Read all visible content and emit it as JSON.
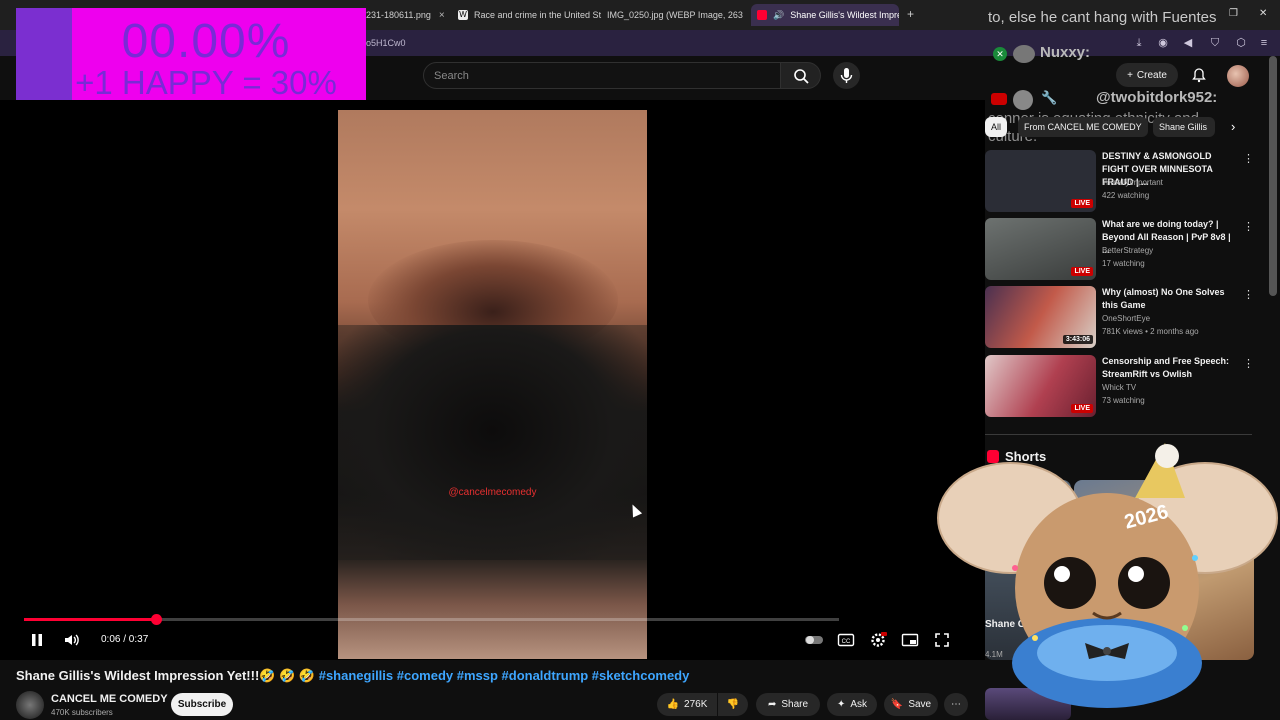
{
  "browser": {
    "tabs": [
      {
        "label": "1231-180611.png",
        "x": 0
      },
      {
        "label": "Race and crime in the United St",
        "x": 1
      },
      {
        "label": "IMG_0250.jpg (WEBP Image, 263",
        "x": 2
      },
      {
        "label": "Shane Gillis's Wildest Impre",
        "x": 3
      }
    ],
    "url_fragment": "o5H1Cw0"
  },
  "overlay": {
    "percent": "00.00%",
    "rule": "+1 HAPPY = 30%"
  },
  "chat": {
    "line1": "to, else he cant hang with Fuentes",
    "user1": "Nuxxy:",
    "user2": "@twobitdork952:",
    "line2": "connor is equating ethnicity and",
    "line3": "culture."
  },
  "header": {
    "search_placeholder": "Search",
    "create_label": "Create"
  },
  "player": {
    "watermark": "@cancelmecomedy",
    "time_current": "0:06",
    "time_total": "0:37",
    "time_display": "0:06 / 0:37",
    "progress_fraction": 0.162,
    "buffered_fraction": 1.0
  },
  "video": {
    "title_text": "Shane Gillis's Wildest Impression Yet!!!🤣 🤣 🤣",
    "hashtags": "#shanegillis #comedy #mssp #donaldtrump #sketchcomedy",
    "channel_name": "CANCEL ME COMEDY",
    "subscribers": "470K subscribers",
    "subscribe_label": "Subscribe",
    "likes": "276K",
    "share_label": "Share",
    "ask_label": "Ask",
    "save_label": "Save"
  },
  "sidebar": {
    "chips": [
      "All",
      "From CANCEL ME COMEDY",
      "Shane Gillis"
    ],
    "recommendations": [
      {
        "title": "DESTINY & ASMONGOLD FIGHT OVER MINNESOTA FRAUD | ...",
        "channel": "imreallyimportant",
        "meta": "422 watching",
        "badge": "LIVE",
        "thumb_color": "#2b2d36"
      },
      {
        "title": "What are we doing today? | Beyond All Reason | PvP 8v8 | ...",
        "channel": "BetterStrategy",
        "meta": "17 watching",
        "badge": "LIVE",
        "thumb_color": "#4a4e4c"
      },
      {
        "title": "Why (almost) No One Solves this Game",
        "channel": "OneShortEye",
        "meta": "781K views • 2 months ago",
        "badge": "3:43:06",
        "thumb_color": "#8a4a4a"
      },
      {
        "title": "Censorship and Free Speech: StreamRift vs Owlish",
        "channel": "Whick TV",
        "meta": "73 watching",
        "badge": "LIVE",
        "thumb_color": "#7b3840"
      }
    ],
    "shorts_label": "Shorts",
    "short_title": "Shane G... Emb...",
    "short_views": "4.1M"
  },
  "mascot": {
    "hat_text": "2026"
  },
  "colors": {
    "accent": "#ff0033",
    "link": "#3ea6ff",
    "overlay_bg": "#ee00ee",
    "overlay_text": "#7a2ad6"
  }
}
